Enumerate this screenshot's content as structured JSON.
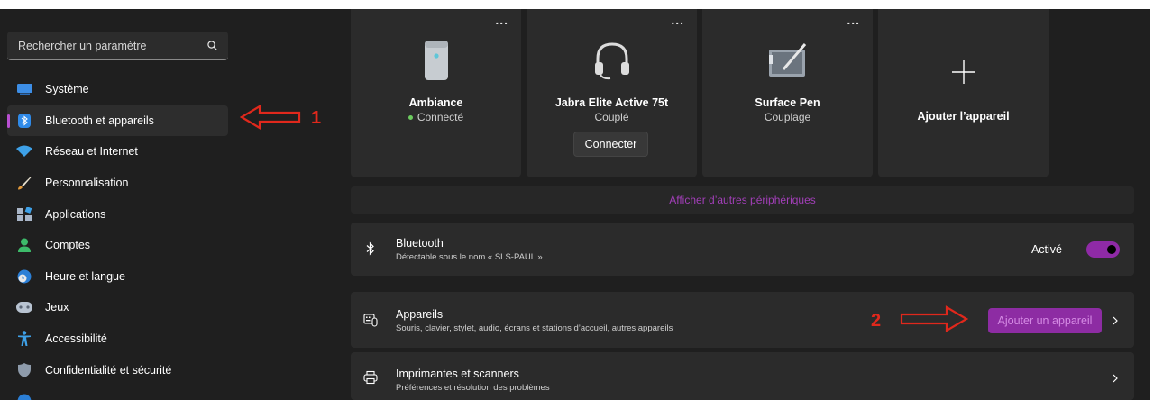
{
  "search": {
    "placeholder": "Rechercher un paramètre"
  },
  "sidebar": {
    "items": [
      {
        "label": "Système",
        "icon": "monitor-icon"
      },
      {
        "label": "Bluetooth et appareils",
        "icon": "bluetooth-icon",
        "active": true
      },
      {
        "label": "Réseau et Internet",
        "icon": "wifi-icon"
      },
      {
        "label": "Personnalisation",
        "icon": "brush-icon"
      },
      {
        "label": "Applications",
        "icon": "apps-icon"
      },
      {
        "label": "Comptes",
        "icon": "account-icon"
      },
      {
        "label": "Heure et langue",
        "icon": "globe-clock-icon"
      },
      {
        "label": "Jeux",
        "icon": "gamepad-icon"
      },
      {
        "label": "Accessibilité",
        "icon": "accessibility-icon"
      },
      {
        "label": "Confidentialité et sécurité",
        "icon": "shield-icon"
      }
    ]
  },
  "annotations": {
    "one": "1",
    "two": "2",
    "color": "#e0281c"
  },
  "devices": [
    {
      "name": "Ambiance",
      "status": "Connecté",
      "connected": true,
      "more": "...",
      "icon": "speaker-icon"
    },
    {
      "name": "Jabra Elite Active 75t",
      "status": "Couplé",
      "button": "Connecter",
      "more": "...",
      "icon": "headset-icon"
    },
    {
      "name": "Surface Pen",
      "status": "Couplage",
      "more": "...",
      "icon": "pen-tablet-icon"
    },
    {
      "name": "Ajouter l’appareil",
      "icon": "plus-icon"
    }
  ],
  "more_devices": {
    "label": "Afficher d’autres périphériques"
  },
  "bluetooth": {
    "title": "Bluetooth",
    "subtitle": "Détectable sous le nom « SLS-PAUL »",
    "toggle_label": "Activé",
    "on": true
  },
  "appareils": {
    "title": "Appareils",
    "subtitle": "Souris, clavier, stylet, audio, écrans et stations d’accueil, autres appareils",
    "button": "Ajouter un appareil"
  },
  "printers": {
    "title": "Imprimantes et scanners",
    "subtitle": "Préférences et résolution des problèmes"
  },
  "colors": {
    "accent": "#8d2ca3",
    "link": "#a23fb8",
    "background": "#1f1f1f",
    "card": "#2b2b2b"
  }
}
